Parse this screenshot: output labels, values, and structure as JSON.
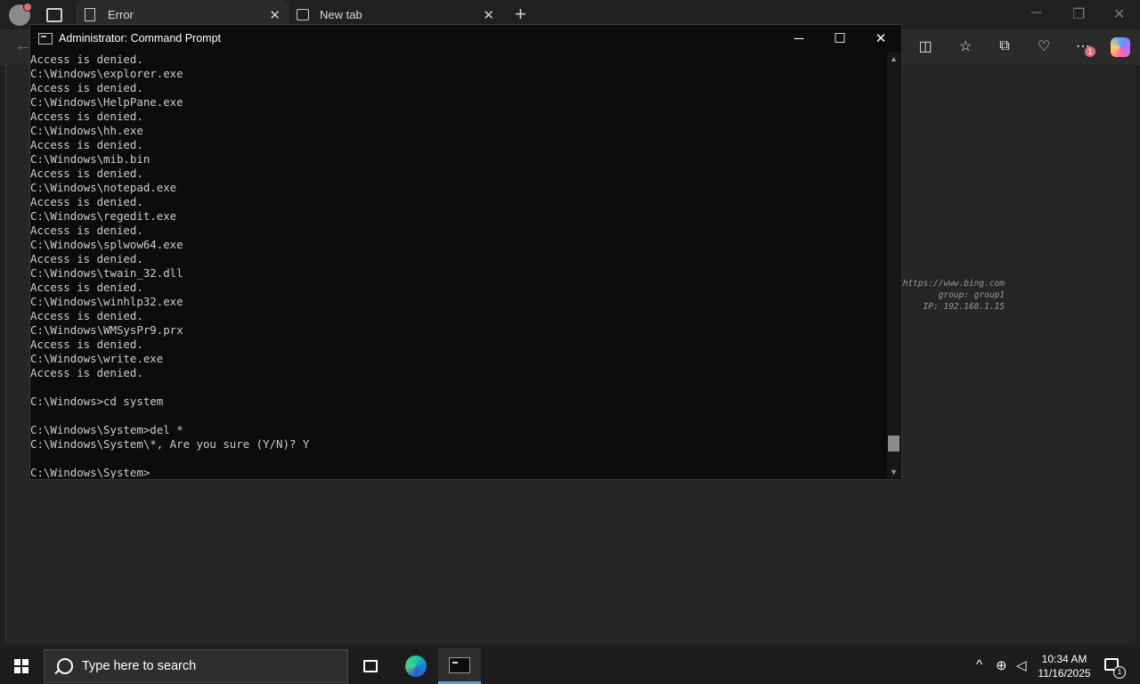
{
  "browser": {
    "tabs": [
      {
        "title": "Error",
        "active": true
      },
      {
        "title": "New tab",
        "active": false
      }
    ],
    "new_tab_symbol": "+",
    "window_controls": {
      "minimize": "─",
      "restore": "❐",
      "close": "✕"
    },
    "bing_info": [
      "https://www.bing.com",
      "group: group1",
      "IP: 192.168.1.15"
    ],
    "downloads_badge": "1"
  },
  "cmd": {
    "title": "Administrator: Command Prompt",
    "controls": {
      "minimize": "─",
      "maximize": "☐",
      "close": "✕"
    },
    "lines": [
      "Access is denied.",
      "C:\\Windows\\explorer.exe",
      "Access is denied.",
      "C:\\Windows\\HelpPane.exe",
      "Access is denied.",
      "C:\\Windows\\hh.exe",
      "Access is denied.",
      "C:\\Windows\\mib.bin",
      "Access is denied.",
      "C:\\Windows\\notepad.exe",
      "Access is denied.",
      "C:\\Windows\\regedit.exe",
      "Access is denied.",
      "C:\\Windows\\splwow64.exe",
      "Access is denied.",
      "C:\\Windows\\twain_32.dll",
      "Access is denied.",
      "C:\\Windows\\winhlp32.exe",
      "Access is denied.",
      "C:\\Windows\\WMSysPr9.prx",
      "Access is denied.",
      "C:\\Windows\\write.exe",
      "Access is denied.",
      "",
      "C:\\Windows>cd system",
      "",
      "C:\\Windows\\System>del *",
      "C:\\Windows\\System\\*, Are you sure (Y/N)? Y",
      "",
      "C:\\Windows\\System>"
    ]
  },
  "taskbar": {
    "search_placeholder": "Type here to search",
    "time": "10:34 AM",
    "date": "11/16/2025",
    "notification_count": "1"
  }
}
